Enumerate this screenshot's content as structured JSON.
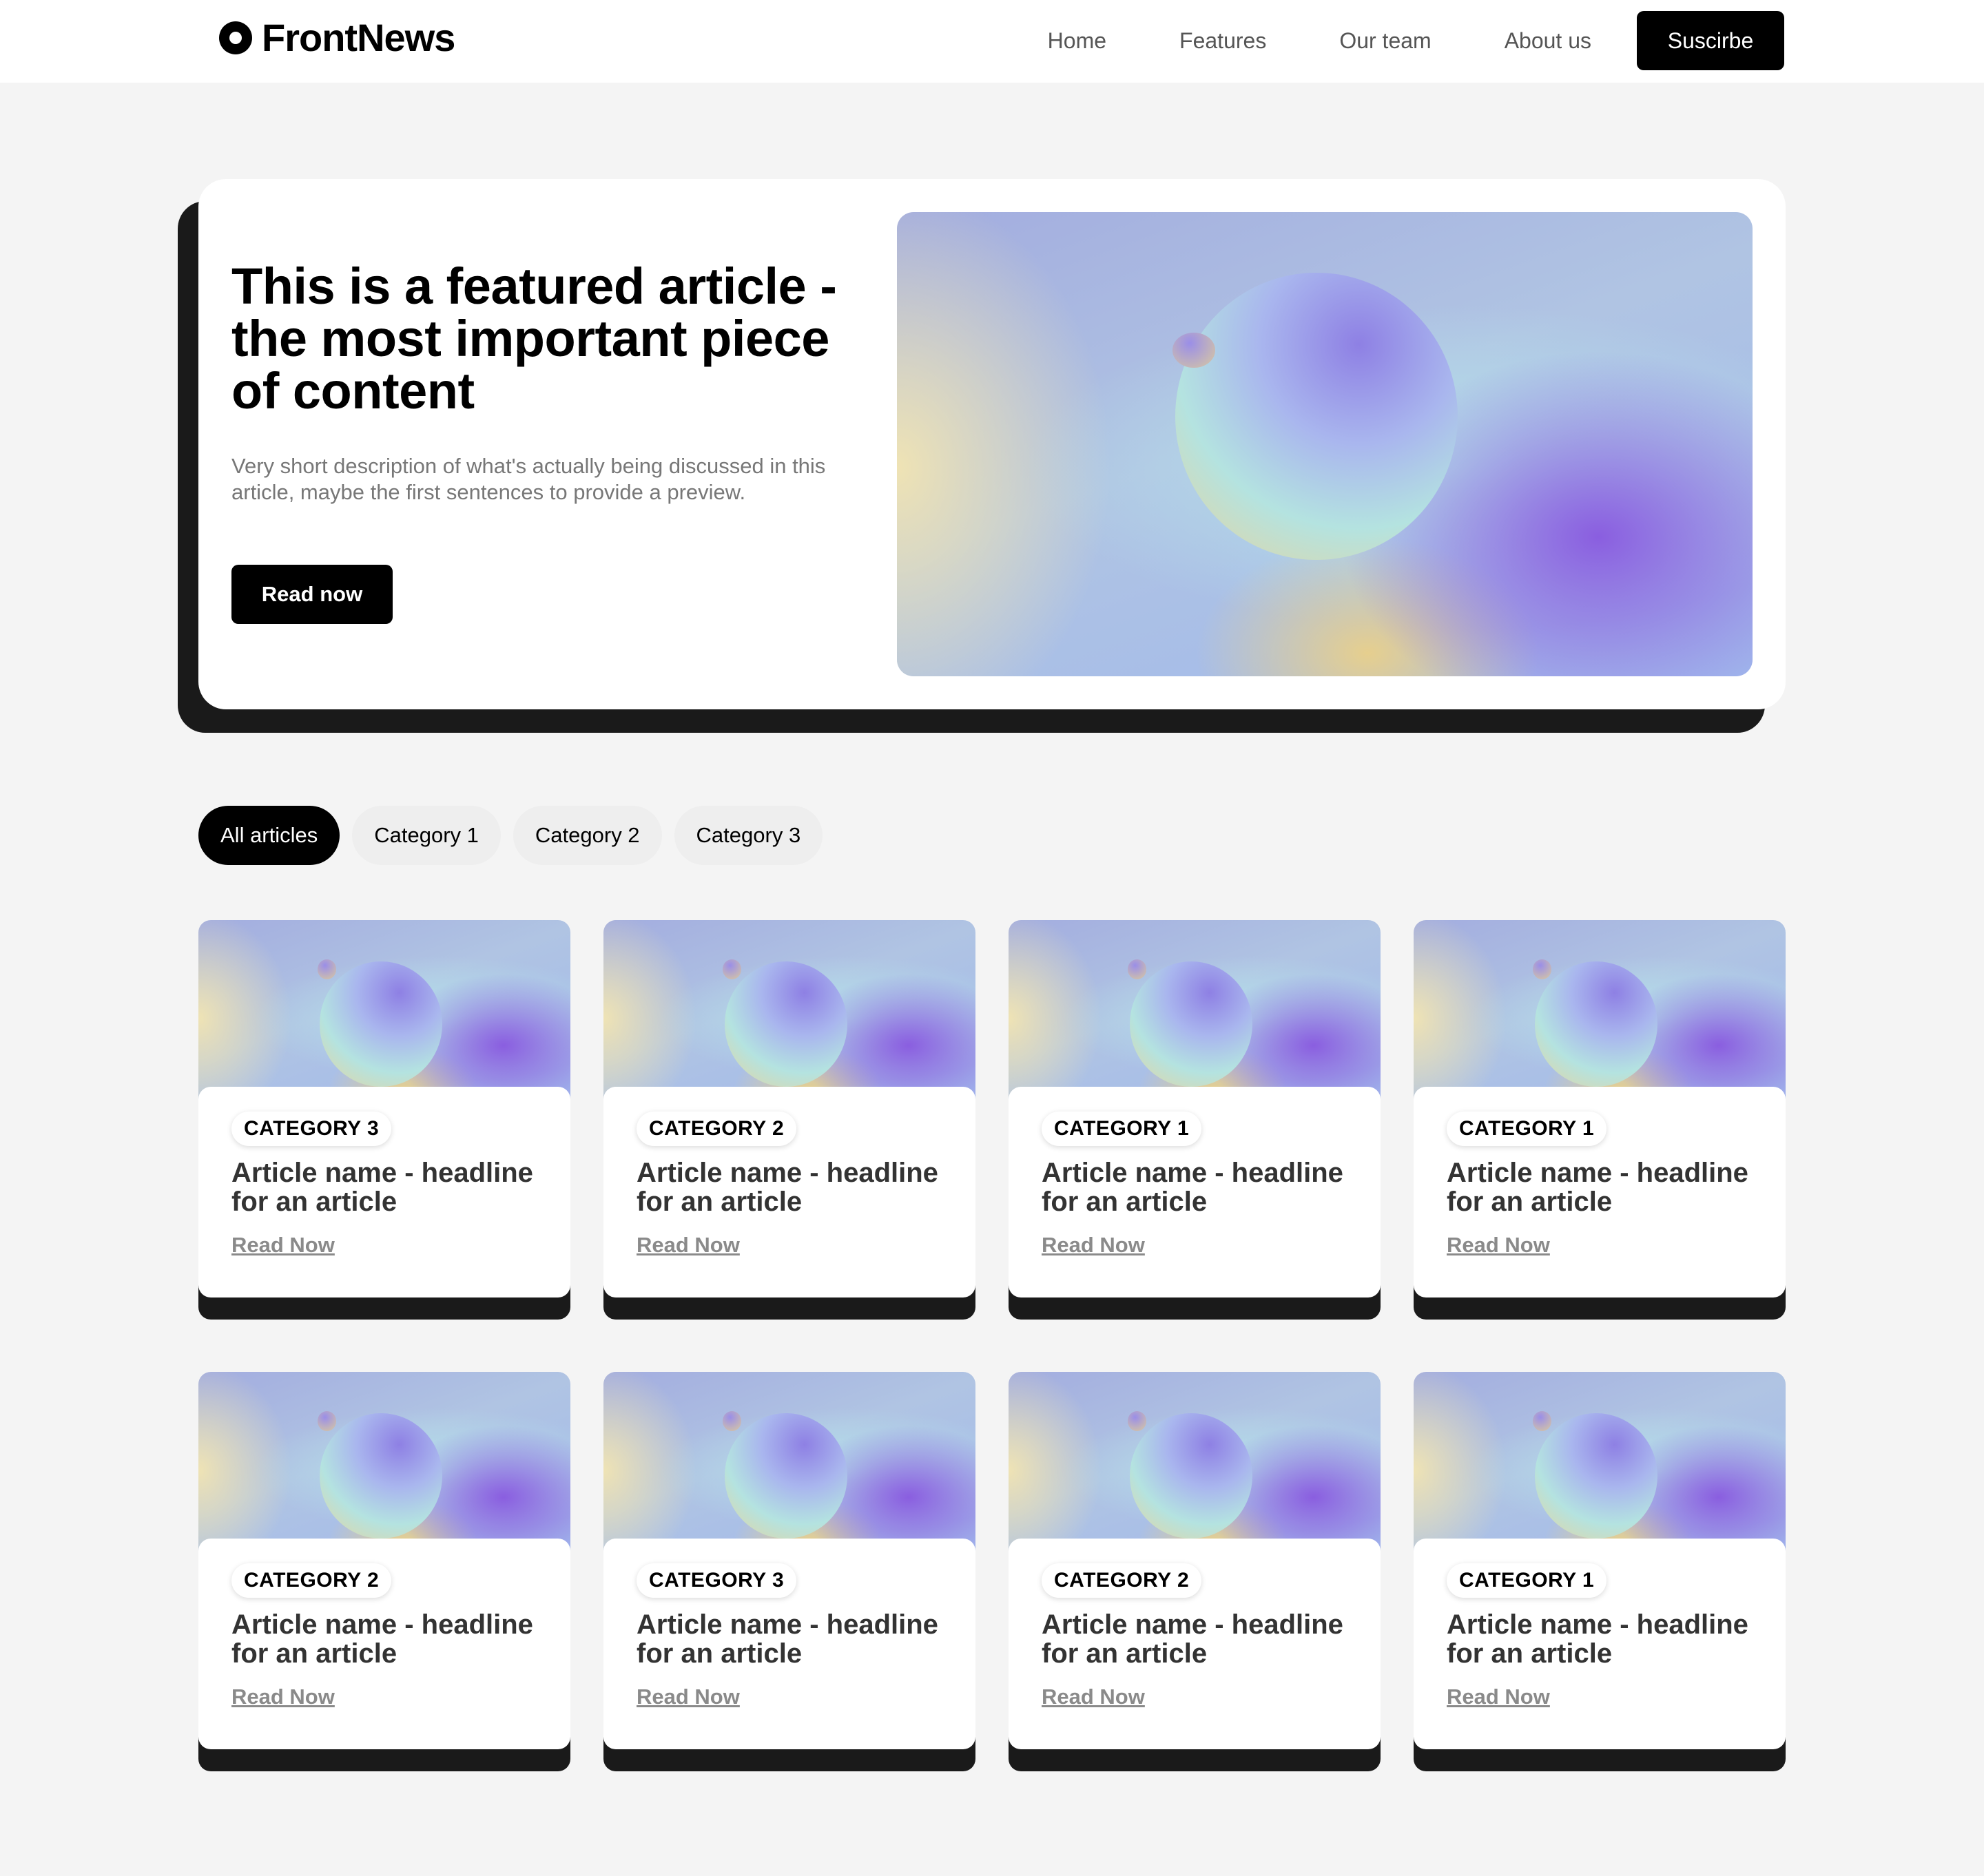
{
  "header": {
    "logo_text": "FrontNews",
    "nav": [
      "Home",
      "Features",
      "Our team",
      "About us"
    ],
    "subscribe_label": "Suscirbe"
  },
  "featured": {
    "title": "This is a featured article - the most important piece of content",
    "description": "Very short description of what's actually being discussed in this article, maybe the first sentences to provide a preview.",
    "button_label": "Read now"
  },
  "filters": {
    "chips": [
      "All articles",
      "Category 1",
      "Category 2",
      "Category 3"
    ],
    "active": "All articles"
  },
  "articles": [
    {
      "category": "CATEGORY 3",
      "title": "Article name - headline for an article",
      "link": "Read Now"
    },
    {
      "category": "CATEGORY 2",
      "title": "Article name - headline for an article",
      "link": "Read Now"
    },
    {
      "category": "CATEGORY 1",
      "title": "Article name - headline for an article",
      "link": "Read Now"
    },
    {
      "category": "CATEGORY 1",
      "title": "Article name - headline for an article",
      "link": "Read Now"
    },
    {
      "category": "CATEGORY 2",
      "title": "Article name - headline for an article",
      "link": "Read Now"
    },
    {
      "category": "CATEGORY 3",
      "title": "Article name - headline for an article",
      "link": "Read Now"
    },
    {
      "category": "CATEGORY 2",
      "title": "Article name - headline for an article",
      "link": "Read Now"
    },
    {
      "category": "CATEGORY 1",
      "title": "Article name - headline for an article",
      "link": "Read Now"
    }
  ],
  "colors": {
    "background": "#f4f4f4",
    "accent": "#000000",
    "shadow": "#1a1a1a",
    "muted_text": "#777777"
  }
}
